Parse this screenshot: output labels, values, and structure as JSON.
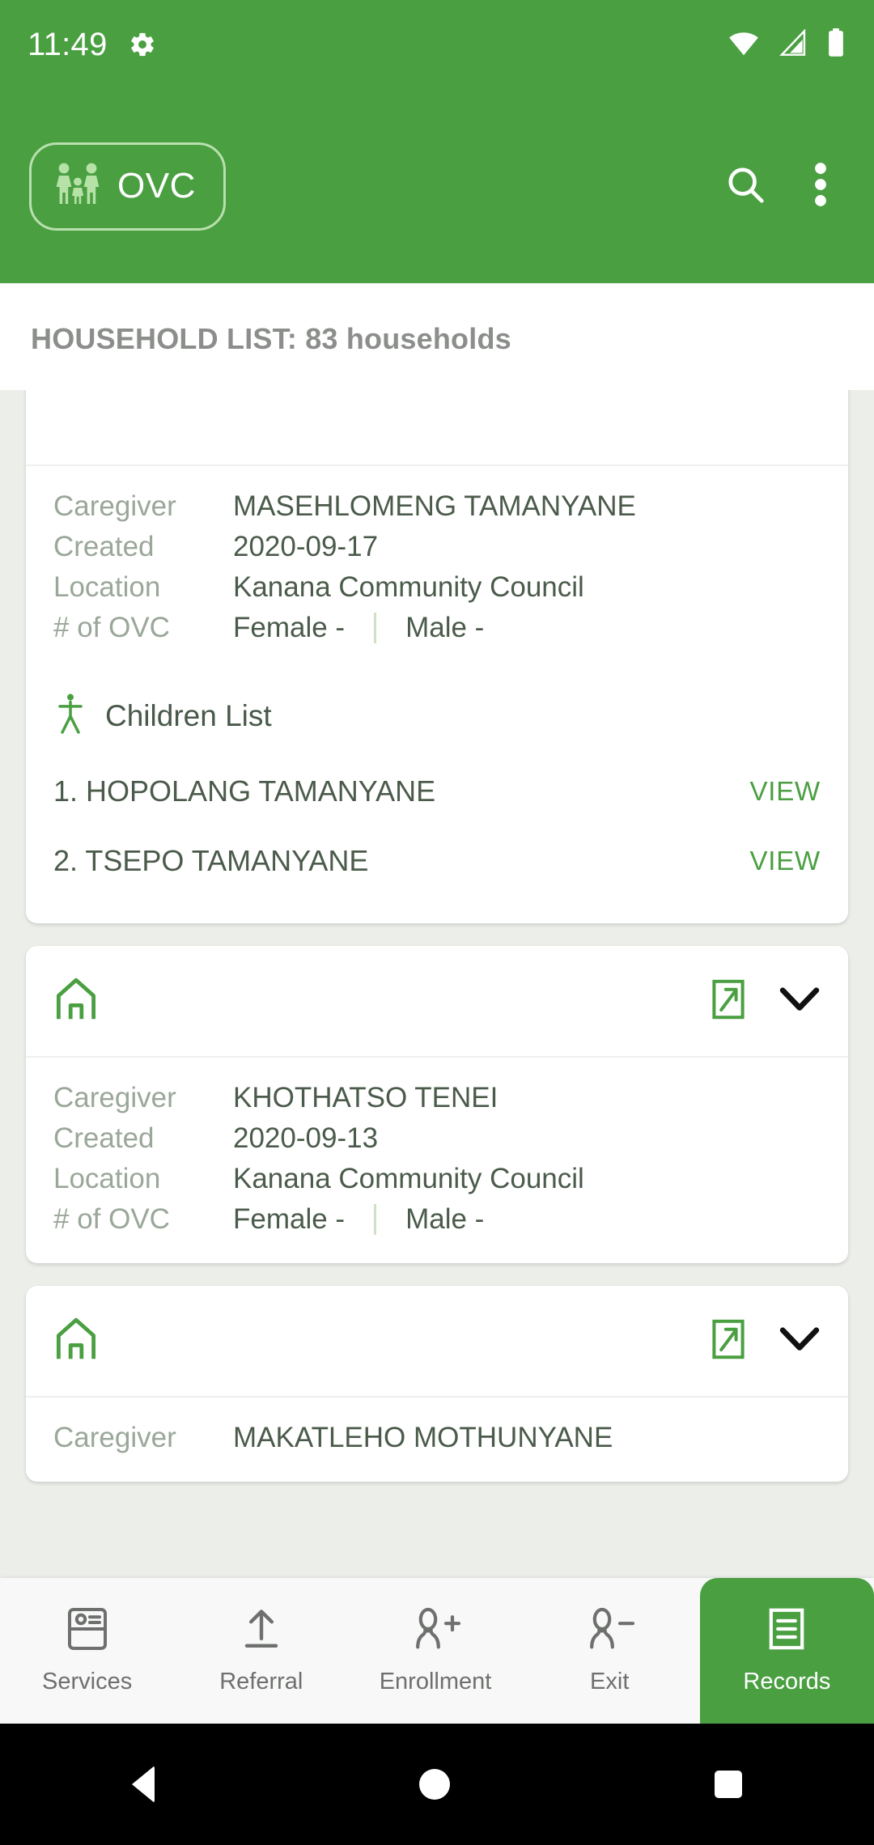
{
  "status_bar": {
    "time": "11:49",
    "icons": [
      "gear-icon",
      "wifi-icon",
      "cellular-signal-icon",
      "battery-icon"
    ]
  },
  "app_bar": {
    "brand_label": "OVC",
    "brand_icon": "family-icon",
    "search_icon": "search-icon",
    "overflow_icon": "more-vertical-icon"
  },
  "list_header": {
    "title": "HOUSEHOLD LIST: 83 households"
  },
  "labels": {
    "caregiver": "Caregiver",
    "created": "Created",
    "location": "Location",
    "num_ovc": "# of OVC",
    "children_list": "Children List",
    "view": "VIEW",
    "female": "Female -",
    "male": "Male -"
  },
  "households": [
    {
      "caregiver": "MASEHLOMENG TAMANYANE",
      "created": "2020-09-17",
      "location": "Kanana Community Council",
      "female": "Female -",
      "male": "Male -",
      "children": [
        {
          "name": "1. HOPOLANG TAMANYANE",
          "action": "VIEW"
        },
        {
          "name": "2. TSEPO TAMANYANE",
          "action": "VIEW"
        }
      ]
    },
    {
      "caregiver": "KHOTHATSO TENEI",
      "created": "2020-09-13",
      "location": "Kanana Community Council",
      "female": "Female -",
      "male": "Male -",
      "children": []
    },
    {
      "caregiver": "MAKATLEHO MOTHUNYANE",
      "created": "",
      "location": "",
      "female": "",
      "male": "",
      "children": []
    }
  ],
  "bottom_nav": [
    {
      "label": "Services",
      "icon": "id-card-icon",
      "active": false
    },
    {
      "label": "Referral",
      "icon": "upload-arrow-icon",
      "active": false
    },
    {
      "label": "Enrollment",
      "icon": "person-plus-icon",
      "active": false
    },
    {
      "label": "Exit",
      "icon": "person-minus-icon",
      "active": false
    },
    {
      "label": "Records",
      "icon": "records-icon",
      "active": true
    }
  ],
  "android_nav": {
    "back": "back-icon",
    "home": "home-icon",
    "recents": "recents-icon"
  },
  "colors": {
    "brand_green": "#4a9f41",
    "link_green": "#4a9f41",
    "page_bg": "#eceeea",
    "card_bg": "#ffffff",
    "label_grey": "#9aa79a",
    "value_grey": "#4b5b4b"
  }
}
